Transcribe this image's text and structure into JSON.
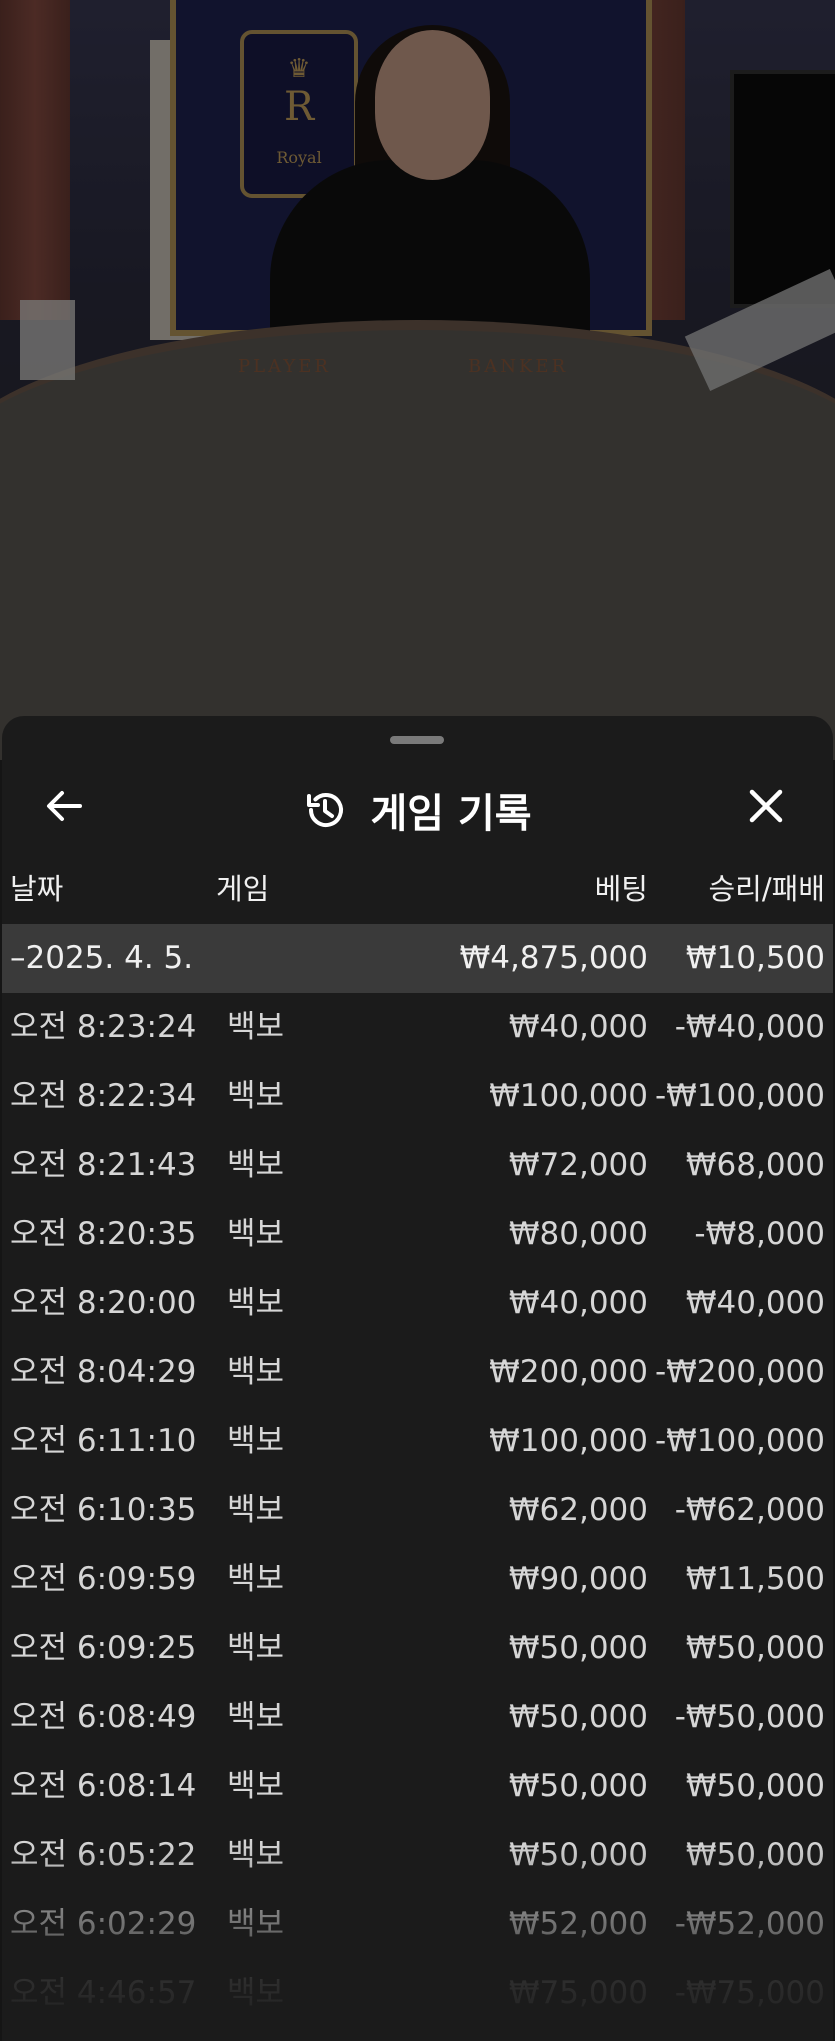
{
  "stage": {
    "table_left_label": "PLAYER",
    "table_right_label": "BANKER",
    "crest_letter": "R",
    "crest_text": "Royal"
  },
  "sheet": {
    "title": "게임 기록",
    "icons": {
      "back": "arrow-left-icon",
      "history": "history-icon",
      "close": "close-icon"
    },
    "columns": {
      "date": "날짜",
      "game": "게임",
      "bet": "베팅",
      "result": "승리/패배"
    },
    "date_group": {
      "date": "2025. 4. 5.",
      "bet": "₩4,875,000",
      "result": "₩10,500"
    },
    "records": [
      {
        "time": "오전 8:23:24",
        "game": "백보",
        "bet": "₩40,000",
        "result": "-₩40,000"
      },
      {
        "time": "오전 8:22:34",
        "game": "백보",
        "bet": "₩100,000",
        "result": "-₩100,000"
      },
      {
        "time": "오전 8:21:43",
        "game": "백보",
        "bet": "₩72,000",
        "result": "₩68,000"
      },
      {
        "time": "오전 8:20:35",
        "game": "백보",
        "bet": "₩80,000",
        "result": "-₩8,000"
      },
      {
        "time": "오전 8:20:00",
        "game": "백보",
        "bet": "₩40,000",
        "result": "₩40,000"
      },
      {
        "time": "오전 8:04:29",
        "game": "백보",
        "bet": "₩200,000",
        "result": "-₩200,000"
      },
      {
        "time": "오전 6:11:10",
        "game": "백보",
        "bet": "₩100,000",
        "result": "-₩100,000"
      },
      {
        "time": "오전 6:10:35",
        "game": "백보",
        "bet": "₩62,000",
        "result": "-₩62,000"
      },
      {
        "time": "오전 6:09:59",
        "game": "백보",
        "bet": "₩90,000",
        "result": "₩11,500"
      },
      {
        "time": "오전 6:09:25",
        "game": "백보",
        "bet": "₩50,000",
        "result": "₩50,000"
      },
      {
        "time": "오전 6:08:49",
        "game": "백보",
        "bet": "₩50,000",
        "result": "-₩50,000"
      },
      {
        "time": "오전 6:08:14",
        "game": "백보",
        "bet": "₩50,000",
        "result": "₩50,000"
      },
      {
        "time": "오전 6:05:22",
        "game": "백보",
        "bet": "₩50,000",
        "result": "₩50,000"
      },
      {
        "time": "오전 6:02:29",
        "game": "백보",
        "bet": "₩52,000",
        "result": "-₩52,000"
      },
      {
        "time": "오전 4:46:57",
        "game": "백보",
        "bet": "₩75,000",
        "result": "-₩75,000"
      }
    ]
  }
}
